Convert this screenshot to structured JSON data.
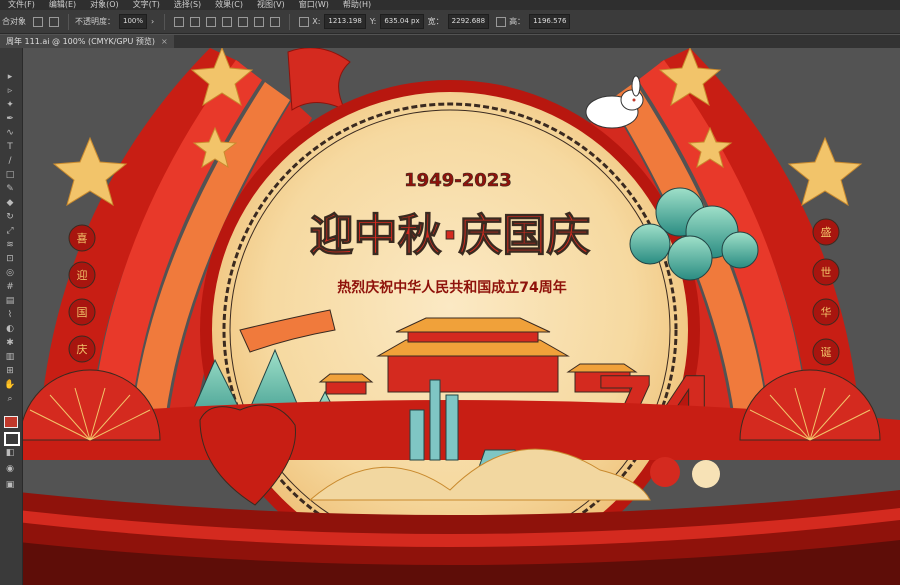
{
  "menu": {
    "items": [
      "文件(F)",
      "编辑(E)",
      "对象(O)",
      "文字(T)",
      "选择(S)",
      "效果(C)",
      "视图(V)",
      "窗口(W)",
      "帮助(H)"
    ]
  },
  "control": {
    "selection_label": "合对象",
    "opacity_label": "不透明度：",
    "opacity_value": "100%",
    "x_label": "X:",
    "x_value": "1213.198",
    "y_label": "Y:",
    "y_value": "635.04 px",
    "w_label": "宽：",
    "w_value": "2292.688",
    "h_label": "高：",
    "h_value": "1196.576"
  },
  "document": {
    "tab_title": "周年 111.ai @ 100% (CMYK/GPU 预览)",
    "close_glyph": "×"
  },
  "artwork": {
    "years": "1949-2023",
    "headline": "迎中秋·庆国庆",
    "subtitle": "热烈庆祝中华人民共和国成立74周年",
    "number": "74",
    "pillar_left": [
      "喜",
      "迎",
      "国",
      "庆"
    ],
    "pillar_right": [
      "盛",
      "世",
      "华",
      "诞"
    ],
    "colors": {
      "red": "#d42a1f",
      "dark_red": "#a8150f",
      "gold": "#f2c46a",
      "cream": "#f7e2b6",
      "teal": "#3aa99b",
      "canvas": "#535353"
    }
  }
}
